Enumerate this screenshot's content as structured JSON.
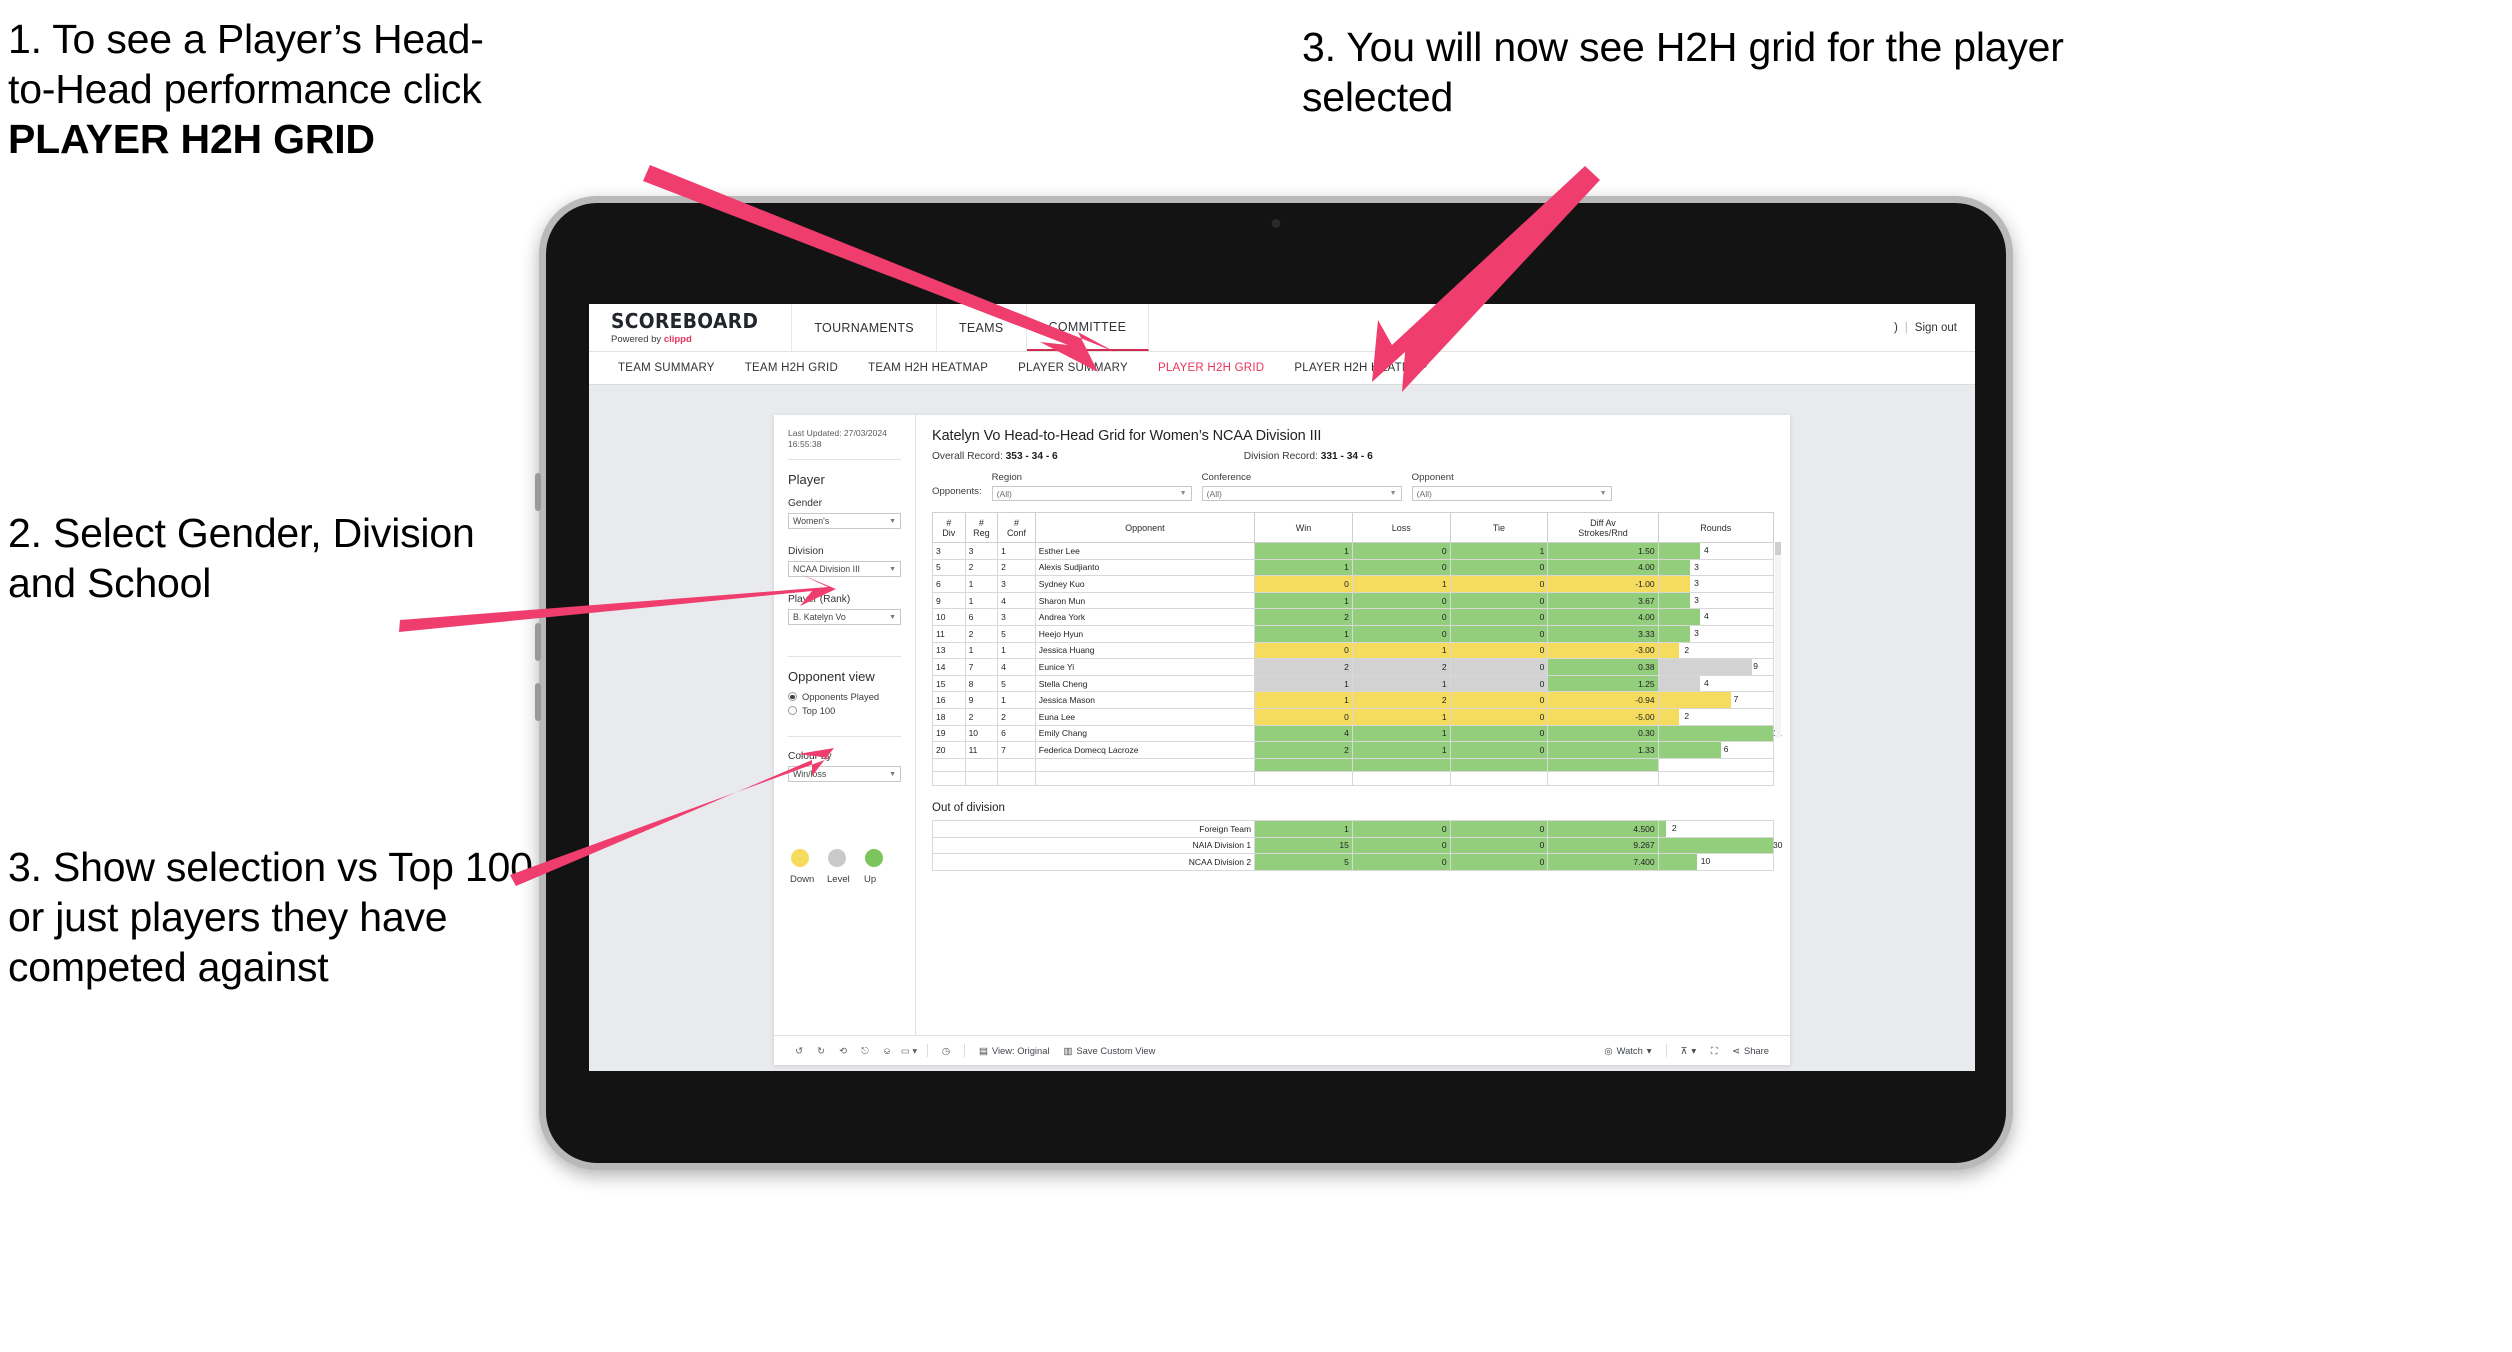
{
  "annotations": {
    "step1_line1": "1. To see a Player’s Head-",
    "step1_line2": "to-Head performance click",
    "step1_bold": "PLAYER H2H GRID",
    "step2": "2. Select Gender, Division and School",
    "step3_left": "3. Show selection vs Top 100 or just players they have competed against",
    "step3_right": "3. You will now see H2H grid for the player selected"
  },
  "topnav": {
    "brand_title": "SCOREBOARD",
    "brand_sub_prefix": "Powered by ",
    "brand_sub_accent": "clippd",
    "items": [
      {
        "label": "TOURNAMENTS"
      },
      {
        "label": "TEAMS"
      },
      {
        "label": "COMMITTEE"
      }
    ],
    "user_fragment": ")",
    "separator": "|",
    "signout": "Sign out"
  },
  "subnav": {
    "tabs": [
      {
        "label": "TEAM SUMMARY",
        "active": false
      },
      {
        "label": "TEAM H2H GRID",
        "active": false
      },
      {
        "label": "TEAM H2H HEATMAP",
        "active": false
      },
      {
        "label": "PLAYER SUMMARY",
        "active": false
      },
      {
        "label": "PLAYER H2H GRID",
        "active": true
      },
      {
        "label": "PLAYER H2H HEATMAP",
        "active": false
      }
    ]
  },
  "sidebar": {
    "last_updated": "Last Updated: 27/03/2024 16:55:38",
    "player_heading": "Player",
    "gender_label": "Gender",
    "gender_value": "Women's",
    "division_label": "Division",
    "division_value": "NCAA Division III",
    "player_rank_label": "Player (Rank)",
    "player_rank_value": "B. Katelyn Vo",
    "opponent_view_heading": "Opponent view",
    "radio_opponents_played": "Opponents Played",
    "radio_top100": "Top 100",
    "colour_by_label": "Colour by",
    "colour_by_value": "Win/loss",
    "legend": [
      {
        "label": "Down",
        "color": "#f5dc5f"
      },
      {
        "label": "Level",
        "color": "#c9c9c9"
      },
      {
        "label": "Up",
        "color": "#7cc45e"
      }
    ]
  },
  "main": {
    "title": "Katelyn Vo Head-to-Head Grid for Women’s NCAA Division III",
    "overall_record_label": "Overall Record: ",
    "overall_record_value": "353 -  34 - 6",
    "division_record_label": "Division Record: ",
    "division_record_value": "331 -  34 - 6",
    "opponents_label": "Opponents:",
    "filters": [
      {
        "label": "Region",
        "value": "(All)"
      },
      {
        "label": "Conference",
        "value": "(All)"
      },
      {
        "label": "Opponent",
        "value": "(All)"
      }
    ],
    "columns": [
      {
        "l1": "#",
        "l2": "Div"
      },
      {
        "l1": "#",
        "l2": "Reg"
      },
      {
        "l1": "#",
        "l2": "Conf"
      },
      {
        "l1": "Opponent",
        "l2": ""
      },
      {
        "l1": "Win",
        "l2": ""
      },
      {
        "l1": "Loss",
        "l2": ""
      },
      {
        "l1": "Tie",
        "l2": ""
      },
      {
        "l1": "Diff Av",
        "l2": "Strokes/Rnd"
      },
      {
        "l1": "Rounds",
        "l2": ""
      }
    ],
    "out_of_division_title": "Out of division"
  },
  "toolbar": {
    "view_label": "View: Original",
    "save_label": "Save Custom View",
    "watch_label": "Watch",
    "share_label": "Share"
  },
  "chart_data": {
    "type": "table",
    "title": "Katelyn Vo Head-to-Head Grid for Women’s NCAA Division III",
    "columns": [
      "# Div",
      "# Reg",
      "# Conf",
      "Opponent",
      "Win",
      "Loss",
      "Tie",
      "Diff Av Strokes/Rnd",
      "Rounds"
    ],
    "colour_scheme": {
      "up": "#93ce7c",
      "down": "#f5dc5f",
      "level": "#d2d2d2"
    },
    "rounds_max": 30,
    "rows": [
      {
        "div": "3",
        "reg": "3",
        "conf": "1",
        "opponent": "Esther Lee",
        "win": "1",
        "loss": "0",
        "tie": "1",
        "diff": "1.50",
        "rounds": 4,
        "state": "up"
      },
      {
        "div": "5",
        "reg": "2",
        "conf": "2",
        "opponent": "Alexis Sudjianto",
        "win": "1",
        "loss": "0",
        "tie": "0",
        "diff": "4.00",
        "rounds": 3,
        "state": "up"
      },
      {
        "div": "6",
        "reg": "1",
        "conf": "3",
        "opponent": "Sydney Kuo",
        "win": "0",
        "loss": "1",
        "tie": "0",
        "diff": "-1.00",
        "rounds": 3,
        "state": "down"
      },
      {
        "div": "9",
        "reg": "1",
        "conf": "4",
        "opponent": "Sharon Mun",
        "win": "1",
        "loss": "0",
        "tie": "0",
        "diff": "3.67",
        "rounds": 3,
        "state": "up"
      },
      {
        "div": "10",
        "reg": "6",
        "conf": "3",
        "opponent": "Andrea York",
        "win": "2",
        "loss": "0",
        "tie": "0",
        "diff": "4.00",
        "rounds": 4,
        "state": "up"
      },
      {
        "div": "11",
        "reg": "2",
        "conf": "5",
        "opponent": "Heejo Hyun",
        "win": "1",
        "loss": "0",
        "tie": "0",
        "diff": "3.33",
        "rounds": 3,
        "state": "up"
      },
      {
        "div": "13",
        "reg": "1",
        "conf": "1",
        "opponent": "Jessica Huang",
        "win": "0",
        "loss": "1",
        "tie": "0",
        "diff": "-3.00",
        "rounds": 2,
        "state": "down"
      },
      {
        "div": "14",
        "reg": "7",
        "conf": "4",
        "opponent": "Eunice Yi",
        "win": "2",
        "loss": "2",
        "tie": "0",
        "diff": "0.38",
        "rounds": 9,
        "state": "level",
        "diff_state": "up"
      },
      {
        "div": "15",
        "reg": "8",
        "conf": "5",
        "opponent": "Stella Cheng",
        "win": "1",
        "loss": "1",
        "tie": "0",
        "diff": "1.25",
        "rounds": 4,
        "state": "level",
        "diff_state": "up"
      },
      {
        "div": "16",
        "reg": "9",
        "conf": "1",
        "opponent": "Jessica Mason",
        "win": "1",
        "loss": "2",
        "tie": "0",
        "diff": "-0.94",
        "rounds": 7,
        "state": "down"
      },
      {
        "div": "18",
        "reg": "2",
        "conf": "2",
        "opponent": "Euna Lee",
        "win": "0",
        "loss": "1",
        "tie": "0",
        "diff": "-5.00",
        "rounds": 2,
        "state": "down"
      },
      {
        "div": "19",
        "reg": "10",
        "conf": "6",
        "opponent": "Emily Chang",
        "win": "4",
        "loss": "1",
        "tie": "0",
        "diff": "0.30",
        "rounds": 11,
        "state": "up"
      },
      {
        "div": "20",
        "reg": "11",
        "conf": "7",
        "opponent": "Federica Domecq Lacroze",
        "win": "2",
        "loss": "1",
        "tie": "0",
        "diff": "1.33",
        "rounds": 6,
        "state": "up"
      }
    ],
    "out_of_division": [
      {
        "name": "Foreign Team",
        "win": "1",
        "loss": "0",
        "tie": "0",
        "diff": "4.500",
        "rounds": 2,
        "state": "up"
      },
      {
        "name": "NAIA Division 1",
        "win": "15",
        "loss": "0",
        "tie": "0",
        "diff": "9.267",
        "rounds": 30,
        "state": "up"
      },
      {
        "name": "NCAA Division 2",
        "win": "5",
        "loss": "0",
        "tie": "0",
        "diff": "7.400",
        "rounds": 10,
        "state": "up"
      }
    ]
  }
}
